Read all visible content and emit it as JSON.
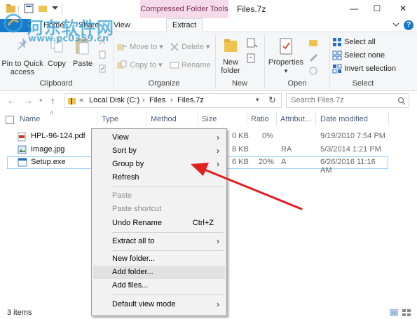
{
  "titlebar": {
    "contextual_tab_header": "Compressed Folder Tools",
    "window_title": "Files.7z",
    "minimize": "—",
    "maximize": "☐",
    "close": "✕"
  },
  "tabs": [
    {
      "label": "Home"
    },
    {
      "label": "Share"
    },
    {
      "label": "View"
    },
    {
      "label": "Extract"
    }
  ],
  "help_icon": "?",
  "ribbon": {
    "clipboard": {
      "pin_to_quick_access": "Pin to Quick access",
      "copy": "Copy",
      "paste": "Paste",
      "group_label": "Clipboard"
    },
    "organize": {
      "move_to": "Move to",
      "copy_to": "Copy to",
      "delete": "Delete",
      "rename": "Rename",
      "group_label": "Organize"
    },
    "new": {
      "new_folder": "New folder",
      "group_label": "New"
    },
    "open": {
      "properties": "Properties",
      "group_label": "Open"
    },
    "select": {
      "select_all": "Select all",
      "select_none": "Select none",
      "invert_selection": "Invert selection",
      "group_label": "Select"
    }
  },
  "address": {
    "chevron": "«",
    "crumbs": [
      "Local Disk (C:)",
      "Files",
      "Files.7z"
    ],
    "search_placeholder": "Search Files.7z"
  },
  "columns": [
    "Name",
    "Type",
    "Method",
    "Size",
    "Ratio",
    "Attribut...",
    "Date modified"
  ],
  "files": [
    {
      "name": "HPL-96-124.pdf",
      "size": "0 KB",
      "ratio": "0%",
      "attr": "",
      "date": "9/19/2010 7:54 PM"
    },
    {
      "name": "Image.jpg",
      "size": "8 KB",
      "ratio": "",
      "attr": "RA",
      "date": "5/3/2014 1:21 PM"
    },
    {
      "name": "Setup.exe",
      "size": "6 KB",
      "ratio": "20%",
      "attr": "A",
      "date": "6/26/2016 11:16 AM"
    }
  ],
  "status": {
    "item_count": "3 items"
  },
  "context_menu": {
    "view": "View",
    "sort_by": "Sort by",
    "group_by": "Group by",
    "refresh": "Refresh",
    "paste": "Paste",
    "paste_shortcut": "Paste shortcut",
    "undo_rename": "Undo Rename",
    "undo_shortcut": "Ctrl+Z",
    "extract_all_to": "Extract all to",
    "new_folder": "New folder...",
    "add_folder": "Add folder...",
    "add_files": "Add files...",
    "default_view_mode": "Default view mode",
    "submenu_arrow": "›"
  },
  "watermark": {
    "site_name": "河东软件网",
    "url": "www.pc0359.cn"
  },
  "colors": {
    "accent_blue": "#1979ca",
    "context_tab_pink": "#f5dbe9",
    "annotation_arrow": "#e02020",
    "selection_border": "#99d1ff"
  }
}
